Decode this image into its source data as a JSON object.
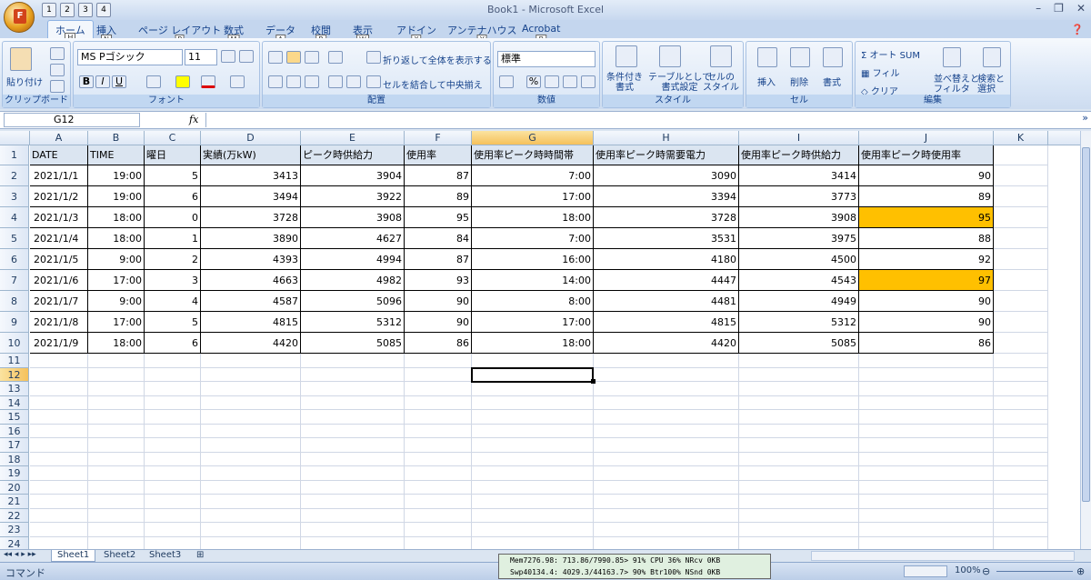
{
  "window": {
    "title": "Book1 - Microsoft Excel",
    "office_button_letter": "F",
    "qat_keys": [
      "1",
      "2",
      "3",
      "4"
    ]
  },
  "tabs": [
    {
      "label": "ホーム",
      "key": "H"
    },
    {
      "label": "挿入",
      "key": "N"
    },
    {
      "label": "ページ レイアウト",
      "key": "P"
    },
    {
      "label": "数式",
      "key": "M"
    },
    {
      "label": "データ",
      "key": "A"
    },
    {
      "label": "校閲",
      "key": "R"
    },
    {
      "label": "表示",
      "key": "W"
    },
    {
      "label": "アドイン",
      "key": "X"
    },
    {
      "label": "アンテナハウス",
      "key": "Y"
    },
    {
      "label": "Acrobat",
      "key": "B"
    }
  ],
  "ribbon": {
    "clipboard": {
      "paste": "貼り付け",
      "group": "クリップボード"
    },
    "font": {
      "name": "MS Pゴシック",
      "size": "11",
      "group": "フォント"
    },
    "alignment": {
      "wrap": "折り返して全体を表示する",
      "merge": "セルを結合して中央揃え",
      "group": "配置"
    },
    "number": {
      "format": "標準",
      "group": "数値"
    },
    "styles": {
      "conditional": "条件付き\n書式",
      "table": "テーブルとして\n書式設定",
      "cell": "セルの\nスタイル",
      "group": "スタイル"
    },
    "cells": {
      "insert": "挿入",
      "delete": "削除",
      "format": "書式",
      "group": "セル"
    },
    "editing": {
      "autosum": "オート SUM",
      "fill": "フィル",
      "clear": "クリア",
      "sort": "並べ替えと\nフィルタ",
      "find": "検索と\n選択",
      "group": "編集"
    }
  },
  "formula_bar": {
    "name_box": "G12",
    "fx": "fx",
    "value": ""
  },
  "sheet": {
    "columns": [
      "A",
      "B",
      "C",
      "D",
      "E",
      "F",
      "G",
      "H",
      "I",
      "J",
      "K"
    ],
    "headers": [
      "DATE",
      "TIME",
      "曜日",
      "実績(万kW)",
      "ピーク時供給力",
      "使用率",
      "使用率ピーク時時間帯",
      "使用率ピーク時需要電力",
      "使用率ピーク時供給力",
      "使用率ピーク時使用率"
    ],
    "rows": [
      [
        "2021/1/1",
        "19:00",
        "5",
        "3413",
        "3904",
        "87",
        "7:00",
        "3090",
        "3414",
        "90"
      ],
      [
        "2021/1/2",
        "19:00",
        "6",
        "3494",
        "3922",
        "89",
        "17:00",
        "3394",
        "3773",
        "89"
      ],
      [
        "2021/1/3",
        "18:00",
        "0",
        "3728",
        "3908",
        "95",
        "18:00",
        "3728",
        "3908",
        "95"
      ],
      [
        "2021/1/4",
        "18:00",
        "1",
        "3890",
        "4627",
        "84",
        "7:00",
        "3531",
        "3975",
        "88"
      ],
      [
        "2021/1/5",
        "9:00",
        "2",
        "4393",
        "4994",
        "87",
        "16:00",
        "4180",
        "4500",
        "92"
      ],
      [
        "2021/1/6",
        "17:00",
        "3",
        "4663",
        "4982",
        "93",
        "14:00",
        "4447",
        "4543",
        "97"
      ],
      [
        "2021/1/7",
        "9:00",
        "4",
        "4587",
        "5096",
        "90",
        "8:00",
        "4481",
        "4949",
        "90"
      ],
      [
        "2021/1/8",
        "17:00",
        "5",
        "4815",
        "5312",
        "90",
        "17:00",
        "4815",
        "5312",
        "90"
      ],
      [
        "2021/1/9",
        "18:00",
        "6",
        "4420",
        "5085",
        "86",
        "18:00",
        "4420",
        "5085",
        "86"
      ]
    ],
    "row_numbers": [
      "1",
      "2",
      "3",
      "4",
      "5",
      "6",
      "7",
      "8",
      "9",
      "10",
      "11",
      "12",
      "13",
      "14",
      "15",
      "16",
      "17",
      "18",
      "19",
      "20",
      "21",
      "22",
      "23",
      "24"
    ],
    "highlight_color": "#FFC000"
  },
  "sheet_tabs": [
    "Sheet1",
    "Sheet2",
    "Sheet3"
  ],
  "status": {
    "mode": "コマンド",
    "zoom": "100%",
    "mem1": "Mem7276.98: 713.86/7990.85> 91% CPU 36% NRcv   0KB",
    "mem2": "Swp40134.4: 4029.3/44163.7> 90% Btr100% NSnd   0KB"
  }
}
